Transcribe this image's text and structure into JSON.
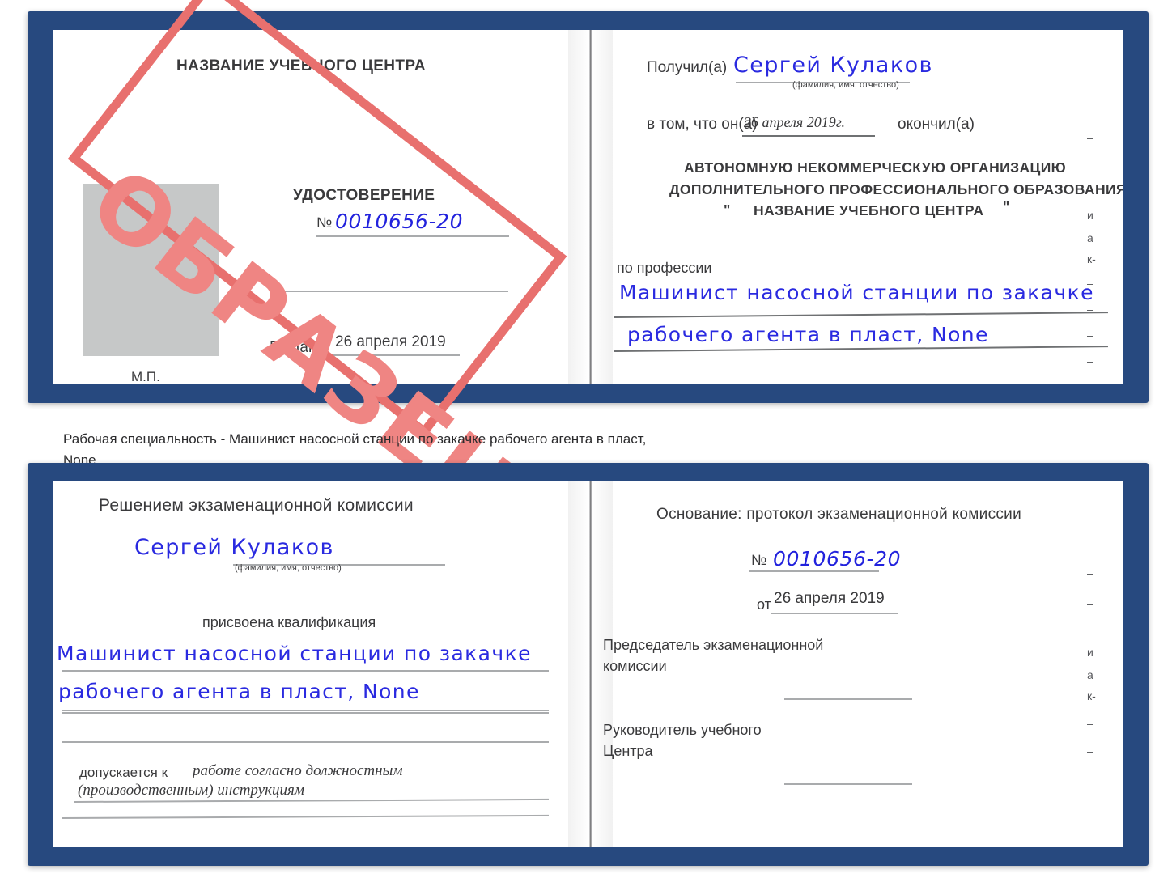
{
  "caption": "Рабочая специальность - Машинист насосной станции по закачке рабочего агента в пласт,\nNone",
  "colors": {
    "cover_blue": "#27497f",
    "ink_blue": "#2222dd",
    "stamp_red": "#e8706e",
    "photo_gray": "#c6c8c8",
    "rule_gray": "#a9abad"
  },
  "stamp": {
    "text": "ОБРАЗЕЦ"
  },
  "cert_front": {
    "org_title": "НАЗВАНИЕ УЧЕБНОГО ЦЕНТРА",
    "doc_type": "УДОСТОВЕРЕНИЕ",
    "number_label": "№",
    "number_value": "0010656-20",
    "issued_label": "Выдано",
    "issued_value": "26 апреля 2019",
    "seal_label": "М.П."
  },
  "cert_inner": {
    "received_label": "Получил(а)",
    "received_value": "Сергей Кулаков",
    "fio_hint": "(фамилия, имя, отчество)",
    "that_he_label": "в том, что он(а)",
    "that_he_date": "26 апреля 2019г.",
    "graduated_label": "окончил(а)",
    "org_line1": "АВТОНОМНУЮ НЕКОММЕРЧЕСКУЮ ОРГАНИЗАЦИЮ",
    "org_line2": "ДОПОЛНИТЕЛЬНОГО ПРОФЕССИОНАЛЬНОГО ОБРАЗОВАНИЯ",
    "org_quote_open": "\"",
    "org_line3": "НАЗВАНИЕ УЧЕБНОГО ЦЕНТРА",
    "org_quote_close": "\"",
    "profession_label": "по профессии",
    "profession_line1": "Машинист насосной станции по закачке",
    "profession_line2": "рабочего агента в пласт, None",
    "edge_fragments": [
      "–",
      "–",
      "–",
      "и",
      "а",
      "к-",
      "–",
      "–",
      "–",
      "–"
    ]
  },
  "decision_left": {
    "heading": "Решением экзаменационной комиссии",
    "name_value": "Сергей Кулаков",
    "fio_hint": "(фамилия, имя, отчество)",
    "qualification_label": "присвоена квалификация",
    "qualification_line1": "Машинист насосной станции по закачке",
    "qualification_line2": "рабочего агента в пласт, None",
    "admitted_label": "допускается к",
    "admitted_line1": "работе согласно должностным",
    "admitted_line2": "(производственным) инструкциям"
  },
  "decision_right": {
    "basis_label": "Основание: протокол экзаменационной комиссии",
    "number_label": "№",
    "number_value": "0010656-20",
    "date_label": "от",
    "date_value": "26 апреля 2019",
    "chairman_line1": "Председатель экзаменационной",
    "chairman_line2": "комиссии",
    "head_line1": "Руководитель учебного",
    "head_line2": "Центра",
    "edge_fragments": [
      "–",
      "–",
      "–",
      "и",
      "а",
      "к-",
      "–",
      "–",
      "–",
      "–"
    ]
  }
}
